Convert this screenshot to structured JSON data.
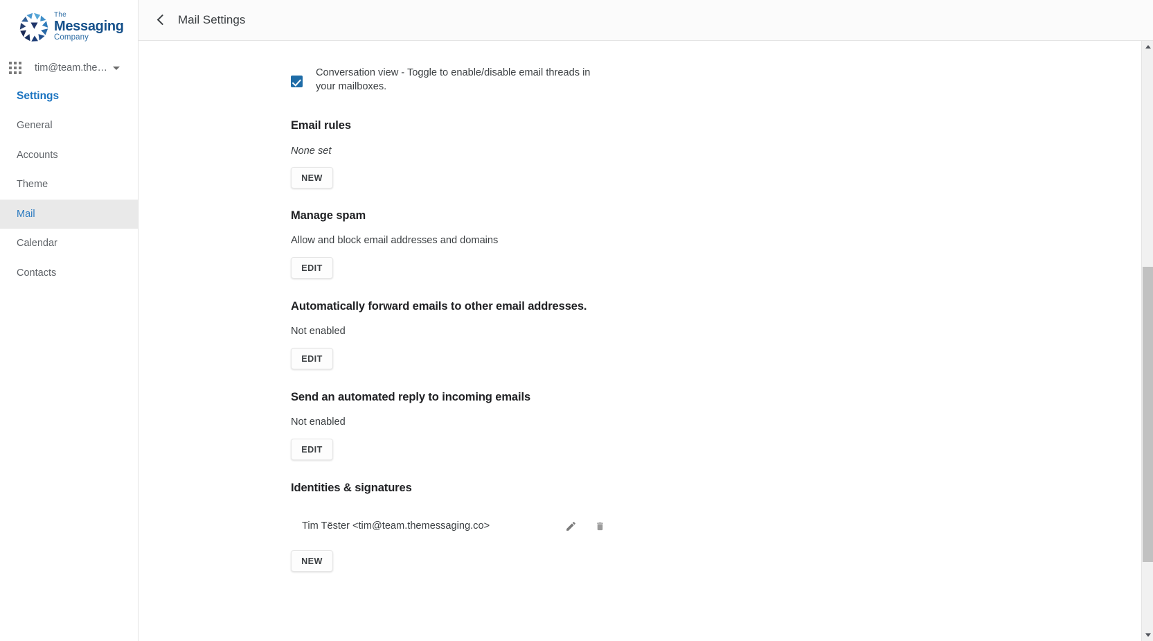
{
  "brand": {
    "logo_line1": "The",
    "logo_line2": "Messaging",
    "logo_line3": "Company",
    "logo_icon": "messaging-company-logo",
    "accent_blue": "#1a73c0",
    "logo_navy": "#15508a"
  },
  "sidebar": {
    "apps_icon": "apps-grid-icon",
    "account": "tim@team.the…",
    "account_caret_icon": "chevron-down-icon",
    "title": "Settings",
    "items": [
      {
        "label": "General",
        "active": false
      },
      {
        "label": "Accounts",
        "active": false
      },
      {
        "label": "Theme",
        "active": false
      },
      {
        "label": "Mail",
        "active": true
      },
      {
        "label": "Calendar",
        "active": false
      },
      {
        "label": "Contacts",
        "active": false
      }
    ]
  },
  "header": {
    "back_icon": "back-chevron-icon",
    "title": "Mail Settings"
  },
  "main": {
    "conversation_view": {
      "checked": true,
      "label": "Conversation view - Toggle to enable/disable email threads in your mailboxes."
    },
    "email_rules": {
      "heading": "Email rules",
      "status": "None set",
      "button": "NEW"
    },
    "manage_spam": {
      "heading": "Manage spam",
      "description": "Allow and block email addresses and domains",
      "button": "EDIT"
    },
    "auto_forward": {
      "heading": "Automatically forward emails to other email addresses.",
      "status": "Not enabled",
      "button": "EDIT"
    },
    "auto_reply": {
      "heading": "Send an automated reply to incoming emails",
      "status": "Not enabled",
      "button": "EDIT"
    },
    "identities": {
      "heading": "Identities & signatures",
      "rows": [
        {
          "label": "Tim Tëster <tim@team.themessaging.co>",
          "edit_icon": "pencil-icon",
          "delete_icon": "trash-icon"
        }
      ],
      "button": "NEW"
    }
  },
  "scrollbar": {
    "up_icon": "scroll-up-arrow-icon",
    "down_icon": "scroll-down-arrow-icon",
    "thumb": "scroll-thumb"
  }
}
